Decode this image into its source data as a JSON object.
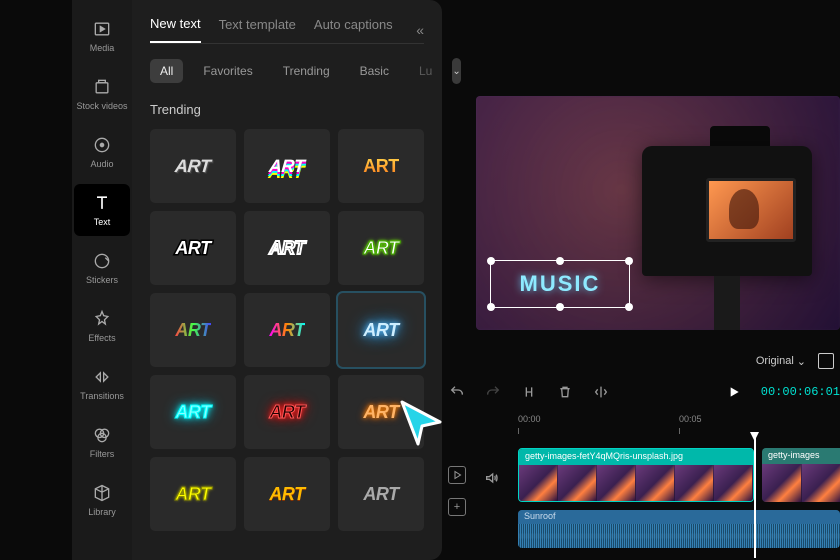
{
  "sidebar": {
    "items": [
      {
        "label": "Media",
        "icon": "media-icon"
      },
      {
        "label": "Stock videos",
        "icon": "stock-icon"
      },
      {
        "label": "Audio",
        "icon": "audio-icon"
      },
      {
        "label": "Text",
        "icon": "text-icon",
        "active": true
      },
      {
        "label": "Stickers",
        "icon": "stickers-icon"
      },
      {
        "label": "Effects",
        "icon": "effects-icon"
      },
      {
        "label": "Transitions",
        "icon": "transitions-icon"
      },
      {
        "label": "Filters",
        "icon": "filters-icon"
      },
      {
        "label": "Library",
        "icon": "library-icon"
      }
    ]
  },
  "text_panel": {
    "tabs": [
      {
        "label": "New text",
        "active": true
      },
      {
        "label": "Text template"
      },
      {
        "label": "Auto captions"
      }
    ],
    "filters": [
      {
        "label": "All",
        "active": true
      },
      {
        "label": "Favorites"
      },
      {
        "label": "Trending"
      },
      {
        "label": "Basic"
      },
      {
        "label": "Lu"
      }
    ],
    "section_title": "Trending",
    "art_sample": "ART"
  },
  "preview": {
    "overlay_text": "MUSIC",
    "ratio_label": "Original"
  },
  "toolbar": {
    "timecode": "00:00:06:01"
  },
  "timeline": {
    "ticks": [
      "00:00",
      "00:05"
    ],
    "clip_main_label": "getty-images-fetY4qMQris-unsplash.jpg",
    "clip_next_label": "getty-images",
    "audio_label": "Sunroof"
  }
}
